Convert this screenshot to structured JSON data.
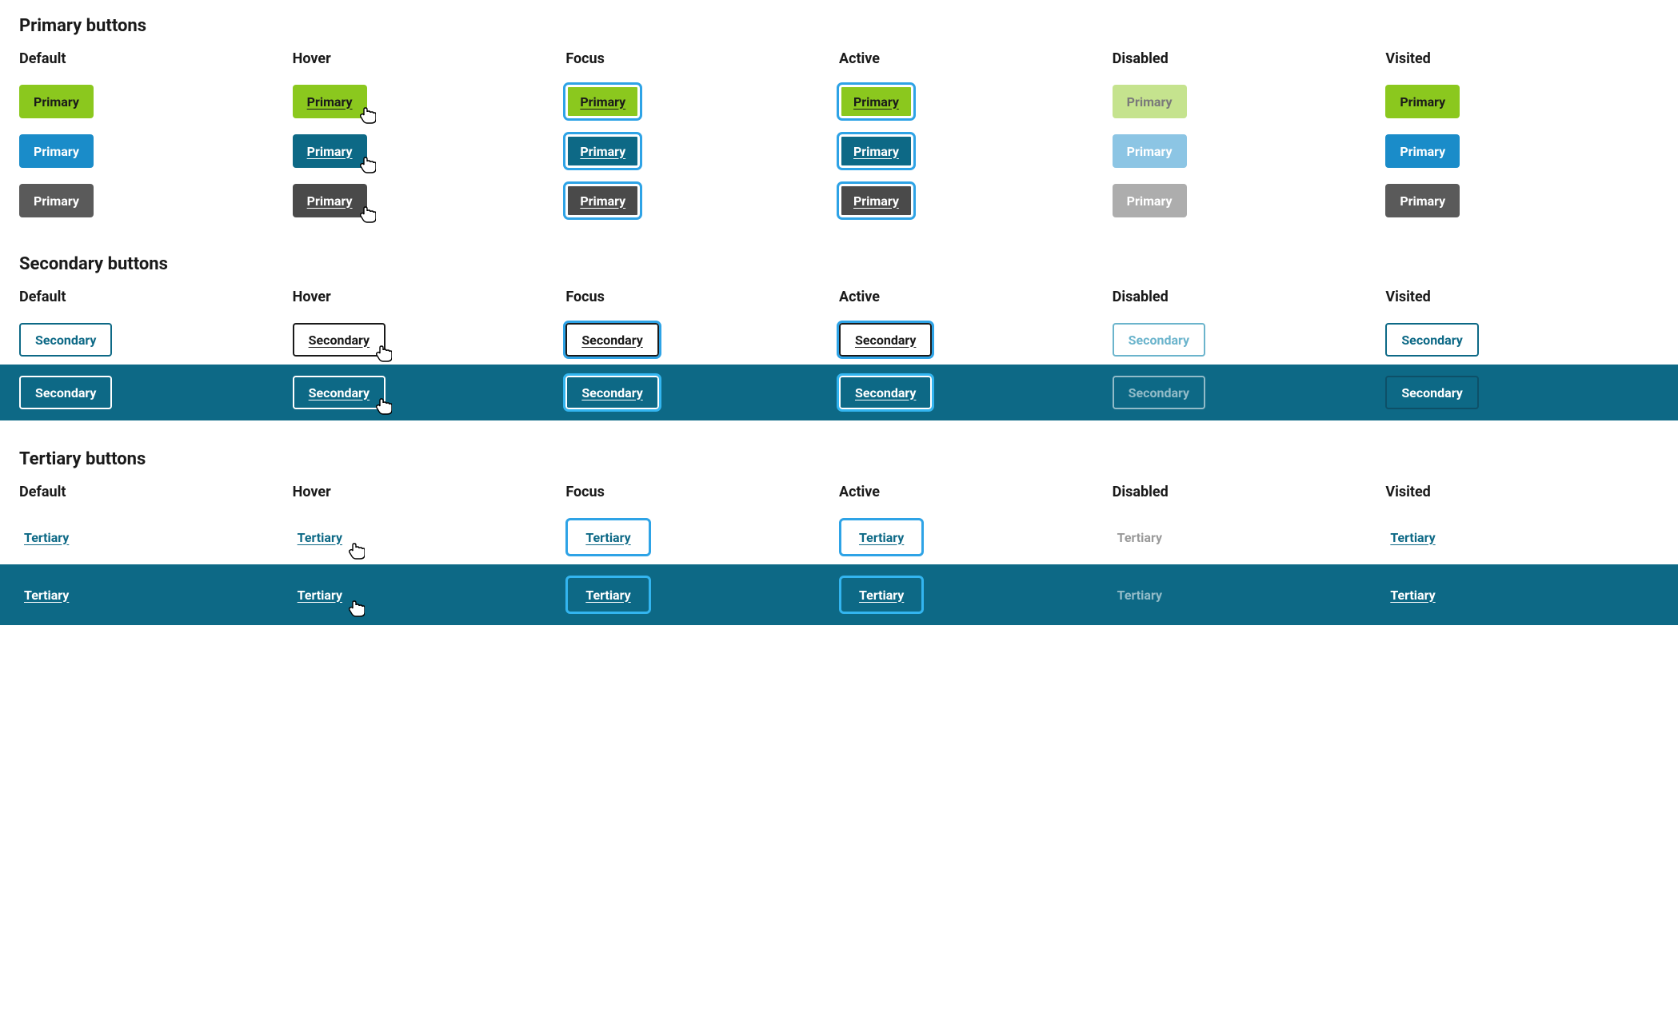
{
  "sections": {
    "primary": {
      "title": "Primary buttons"
    },
    "secondary": {
      "title": "Secondary buttons"
    },
    "tertiary": {
      "title": "Tertiary buttons"
    }
  },
  "states": {
    "default": "Default",
    "hover": "Hover",
    "focus": "Focus",
    "active": "Active",
    "disabled": "Disabled",
    "visited": "Visited"
  },
  "labels": {
    "primary": "Primary",
    "secondary": "Secondary",
    "tertiary": "Tertiary"
  },
  "colors": {
    "green": "#8bc81e",
    "green_dis": "#c5e38e",
    "blue": "#1a8cc9",
    "blue_hover": "#0d6986",
    "blue_dis": "#8cc5e4",
    "gray": "#5a5a5a",
    "gray_hover": "#4a4a4a",
    "gray_dis": "#adadad",
    "teal_band": "#0d6986",
    "focus_ring": "#2ea3e6"
  }
}
